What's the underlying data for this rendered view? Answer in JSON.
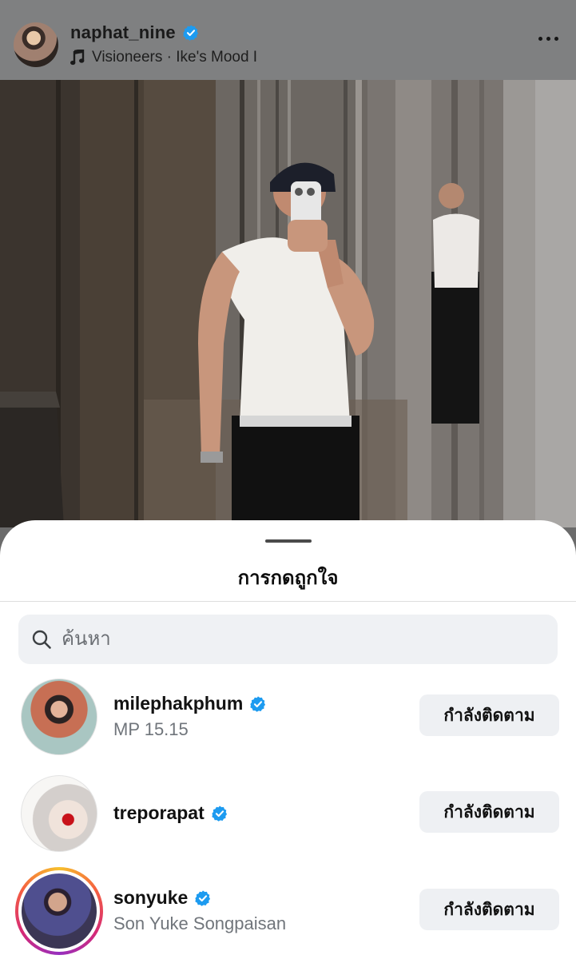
{
  "post": {
    "username": "naphat_nine",
    "audio": "Visioneers · Ike's Mood I"
  },
  "sheet": {
    "title": "การกดถูกใจ",
    "search_placeholder": "ค้นหา"
  },
  "likers": [
    {
      "username": "milephakphum",
      "subtitle": "MP 15.15",
      "button": "กำลังติดตาม",
      "verified": true
    },
    {
      "username": "treporapat",
      "subtitle": "",
      "button": "กำลังติดตาม",
      "verified": true
    },
    {
      "username": "sonyuke",
      "subtitle": "Son Yuke Songpaisan",
      "button": "กำลังติดตาม",
      "verified": true,
      "has_story": true
    }
  ],
  "colors": {
    "verified_badge": "#1d9bf0",
    "button_bg": "#eef0f3"
  }
}
